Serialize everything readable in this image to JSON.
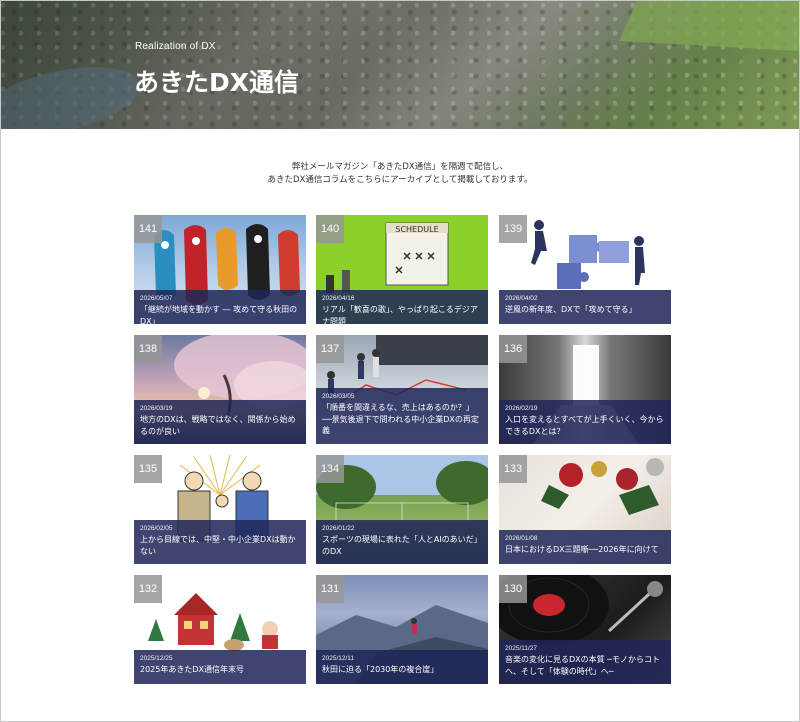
{
  "hero": {
    "subtitle": "Realization of DX",
    "title": "あきたDX通信"
  },
  "intro": {
    "line1": "弊社メールマガジン「あきたDX通信」を隔週で配信し、",
    "line2": "あきたDX通信コラムをこちらにアーカイブとして掲載しております。"
  },
  "articles": [
    {
      "number": "141",
      "date": "2026/05/07",
      "title": "「継続が地域を動かす ― 攻めて守る秋田のDX」",
      "image": "koinobori-photo"
    },
    {
      "number": "140",
      "date": "2026/04/16",
      "title": "リアル「歓喜の歌」、やっぱり起こるデジアナ問題",
      "image": "schedule-calendar-photo"
    },
    {
      "number": "139",
      "date": "2026/04/02",
      "title": "逆風の新年度、DXで「攻めて守る」",
      "image": "puzzle-business-illustration"
    },
    {
      "number": "138",
      "date": "2026/03/19",
      "title": "地方のDXは、戦略ではなく、関係から始めるのが良い",
      "image": "cherry-blossom-photo"
    },
    {
      "number": "137",
      "date": "2026/03/05",
      "title": "「順番を間違えるな、売上はあるのか？」──景気後退下で問われる中小企業DXの再定義",
      "image": "chart-figures-photo"
    },
    {
      "number": "136",
      "date": "2026/02/19",
      "title": "入口を変えるとすべてが上手くいく、今からできるDXとは？",
      "image": "bright-door-photo"
    },
    {
      "number": "135",
      "date": "2026/02/05",
      "title": "上から目線では、中堅・中小企業DXは動かない",
      "image": "fist-bump-illustration"
    },
    {
      "number": "134",
      "date": "2026/01/22",
      "title": "スポーツの現場に表れた「人とAIのあいだ」のDX",
      "image": "sports-field-photo"
    },
    {
      "number": "133",
      "date": "2026/01/08",
      "title": "日本におけるDX三題噺──2026年に向けて",
      "image": "christmas-ornaments-photo"
    },
    {
      "number": "132",
      "date": "2025/12/25",
      "title": "2025年あきたDX通信年末号",
      "image": "christmas-house-photo"
    },
    {
      "number": "131",
      "date": "2025/12/11",
      "title": "秋田に迫る「2030年の複合崖」",
      "image": "mountain-hiker-photo"
    },
    {
      "number": "130",
      "date": "2025/11/27",
      "title": "音楽の変化に見るDXの本質 ─モノからコトへ、そして「体験の時代」へ─",
      "image": "vinyl-record-photo"
    }
  ]
}
